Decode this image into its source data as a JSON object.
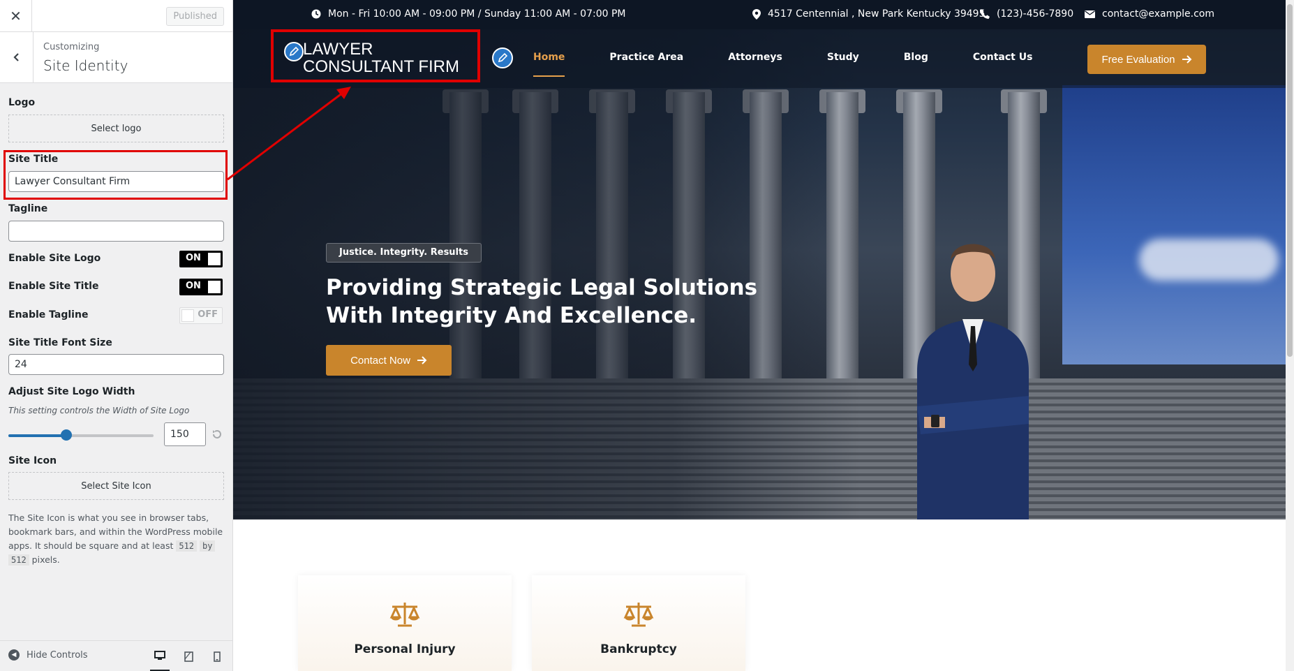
{
  "customizer": {
    "close_icon": "close-icon",
    "published_label": "Published",
    "breadcrumb": "Customizing",
    "section_title": "Site Identity",
    "logo": {
      "label": "Logo",
      "button": "Select logo"
    },
    "site_title": {
      "label": "Site Title",
      "value": "Lawyer Consultant Firm"
    },
    "tagline": {
      "label": "Tagline",
      "value": ""
    },
    "enable_site_logo": {
      "label": "Enable Site Logo",
      "state": "ON"
    },
    "enable_site_title": {
      "label": "Enable Site Title",
      "state": "ON"
    },
    "enable_tagline": {
      "label": "Enable Tagline",
      "state": "OFF"
    },
    "site_title_font_size": {
      "label": "Site Title Font Size",
      "value": "24"
    },
    "logo_width": {
      "label": "Adjust Site Logo Width",
      "description": "This setting controls the Width of Site Logo",
      "value": "150",
      "slider_fraction": 0.4
    },
    "site_icon": {
      "label": "Site Icon",
      "button": "Select Site Icon",
      "desc_1": "The Site Icon is what you see in browser tabs, bookmark bars, and within the WordPress mobile apps. It should be square and at least",
      "code_1": "512",
      "desc_by": "by",
      "code_2": "512",
      "desc_2": "pixels."
    },
    "footer": {
      "hide_controls": "Hide Controls"
    }
  },
  "preview": {
    "topbar": {
      "hours": "Mon - Fri 10:00 AM - 09:00 PM / Sunday 11:00 AM - 07:00 PM",
      "address": "4517 Centennial , New Park Kentucky 39495",
      "phone": "(123)-456-7890",
      "email": "contact@example.com"
    },
    "site_title": "LAWYER CONSULTANT FIRM",
    "nav": [
      "Home",
      "Practice Area",
      "Attorneys",
      "Study",
      "Blog",
      "Contact Us"
    ],
    "header_cta": "Free Evaluation",
    "hero": {
      "badge": "Justice. Integrity. Results",
      "heading": "Providing Strategic Legal Solutions With Integrity And Excellence.",
      "cta": "Contact Now"
    },
    "cards": [
      {
        "title": "Personal Injury",
        "icon": "scales-icon"
      },
      {
        "title": "Bankruptcy",
        "icon": "scales-icon"
      }
    ]
  },
  "colors": {
    "accent": "#c9852c",
    "nav_active": "#e6a04c",
    "topbar": "#0d1624",
    "annotation": "#e00000",
    "wp_blue": "#2271b1"
  }
}
